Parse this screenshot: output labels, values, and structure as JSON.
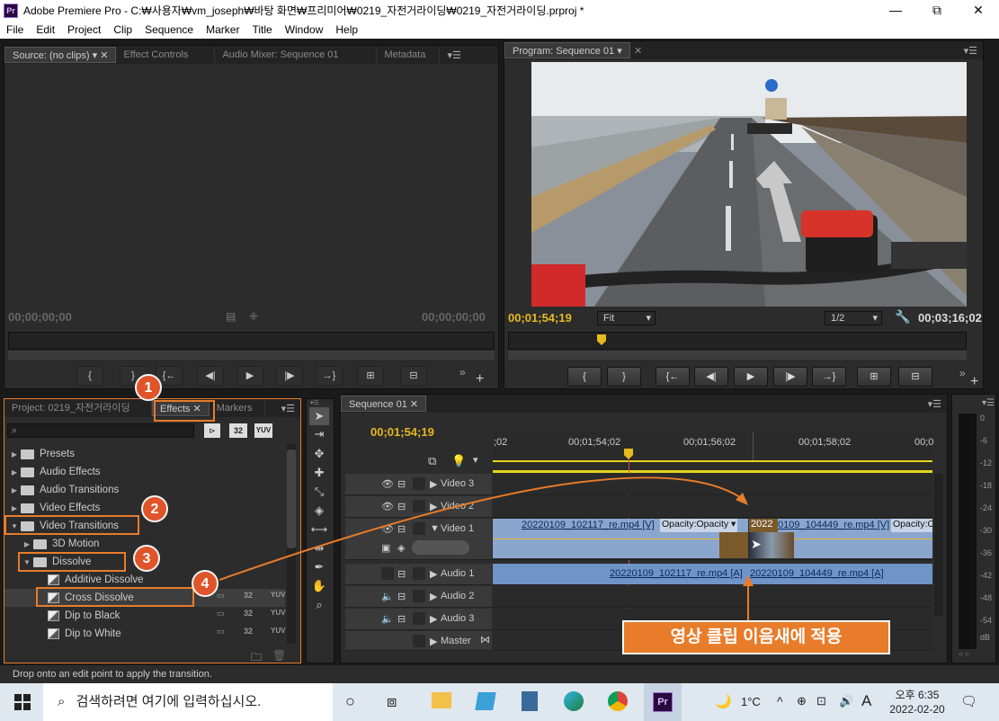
{
  "window": {
    "app_icon": "Pr",
    "title": "Adobe Premiere Pro - C:₩사용자₩vm_joseph₩바탕 화면₩프리미어₩0219_자전거라이딩₩0219_자전거라이딩.prproj *"
  },
  "menu": [
    "File",
    "Edit",
    "Project",
    "Clip",
    "Sequence",
    "Marker",
    "Title",
    "Window",
    "Help"
  ],
  "source_panel": {
    "tabs": [
      "Source: (no clips)",
      "Effect Controls",
      "Audio Mixer: Sequence 01",
      "Metadata"
    ],
    "timecode_left": "00;00;00;00",
    "timecode_right": "00;00;00;00"
  },
  "program_panel": {
    "tab": "Program: Sequence 01",
    "timecode_left": "00;01;54;19",
    "fit": "Fit",
    "resolution": "1/2",
    "timecode_right": "00;03;16;02"
  },
  "project_panel": {
    "tabs": [
      "Project: 0219_자전거라이딩",
      "Effects",
      "Markers"
    ],
    "search_placeholder": "",
    "icon_labels": [
      "32",
      "YUV"
    ],
    "tree": [
      {
        "label": "Presets",
        "indent": 0,
        "open": false
      },
      {
        "label": "Audio Effects",
        "indent": 0,
        "open": false
      },
      {
        "label": "Audio Transitions",
        "indent": 0,
        "open": false
      },
      {
        "label": "Video Effects",
        "indent": 0,
        "open": false
      },
      {
        "label": "Video Transitions",
        "indent": 0,
        "open": true
      },
      {
        "label": "3D Motion",
        "indent": 1,
        "open": false
      },
      {
        "label": "Dissolve",
        "indent": 1,
        "open": true
      },
      {
        "label": "Additive Dissolve",
        "indent": 2,
        "item": true
      },
      {
        "label": "Cross Dissolve",
        "indent": 2,
        "item": true,
        "selected": true
      },
      {
        "label": "Dip to Black",
        "indent": 2,
        "item": true
      },
      {
        "label": "Dip to White",
        "indent": 2,
        "item": true
      }
    ]
  },
  "timeline": {
    "tab": "Sequence 01",
    "timecode": "00;01;54;19",
    "ruler": [
      ";02",
      "00;01;54;02",
      "00;01;56;02",
      "00;01;58;02",
      "00;0"
    ],
    "tracks": {
      "video3": "Video 3",
      "video2": "Video 2",
      "video1": "Video 1",
      "audio1": "Audio 1",
      "audio2": "Audio 2",
      "audio3": "Audio 3",
      "master": "Master"
    },
    "clip_v1a": "20220109_102117_re.mp4 [V]",
    "clip_v1a_fx": "Opacity:Opacity",
    "clip_v1b_prefix": "2022",
    "clip_v1b": "0109_104449_re.mp4 [V]",
    "clip_v1b_fx": "Opacity:O",
    "clip_a1a": "20220109_102117_re.mp4 [A]",
    "clip_a1b": "20220109_104449_re.mp4 [A]"
  },
  "vu_meter": [
    "0",
    "-6",
    "-12",
    "-18",
    "-24",
    "-30",
    "-36",
    "-42",
    "-48",
    "-54",
    "dB"
  ],
  "annotations": {
    "badges": [
      "1",
      "2",
      "3",
      "4"
    ],
    "callout": "영상 클립 이음새에 적용"
  },
  "status_bar": "Drop onto an edit point to apply the transition.",
  "taskbar": {
    "search_placeholder": "검색하려면 여기에 입력하십시오.",
    "weather": "1°C",
    "ime": "A",
    "time_period": "오후 6:35",
    "date": "2022-02-20"
  },
  "colors": {
    "timecode_yellow": "#e6b91e",
    "highlight_orange": "#e87c2a",
    "badge": "#e0542a",
    "clip_video": "#8aa6cf",
    "clip_audio": "#6f94c8"
  }
}
